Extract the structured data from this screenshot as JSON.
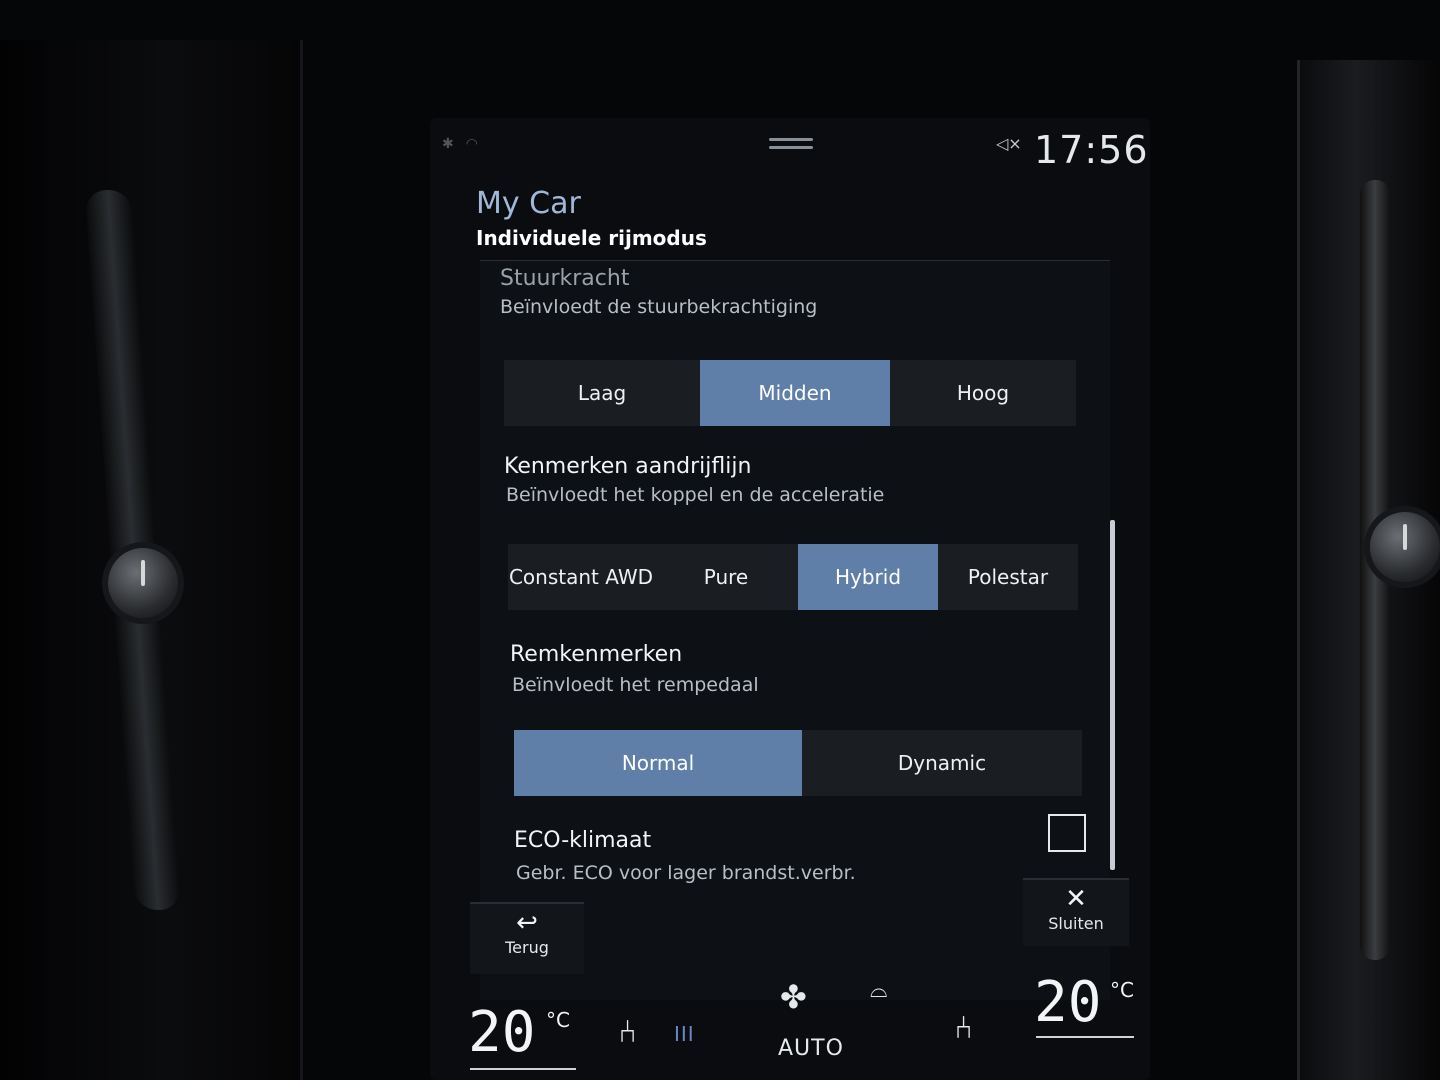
{
  "status": {
    "time": "17:56"
  },
  "header": {
    "title": "My Car",
    "subtitle": "Individuele rijmodus"
  },
  "settings": {
    "steering": {
      "title": "Stuurkracht",
      "desc": "Beïnvloedt de stuurbekrachtiging",
      "options": [
        "Laag",
        "Midden",
        "Hoog"
      ],
      "selected": "Midden"
    },
    "powertrain": {
      "title": "Kenmerken aandrijflijn",
      "desc": "Beïnvloedt het koppel en de acceleratie",
      "options": [
        "Constant AWD",
        "Pure",
        "Hybrid",
        "Polestar"
      ],
      "selected": "Hybrid"
    },
    "brakes": {
      "title": "Remkenmerken",
      "desc": "Beïnvloedt het rempedaal",
      "options": [
        "Normal",
        "Dynamic"
      ],
      "selected": "Normal"
    },
    "eco": {
      "title": "ECO-klimaat",
      "desc": "Gebr. ECO voor lager brandst.verbr.",
      "checked": false
    }
  },
  "buttons": {
    "back_label": "Terug",
    "close_label": "Sluiten"
  },
  "climate": {
    "left_temp": "20",
    "right_temp": "20",
    "unit": "°C",
    "auto_label": "AUTO"
  }
}
